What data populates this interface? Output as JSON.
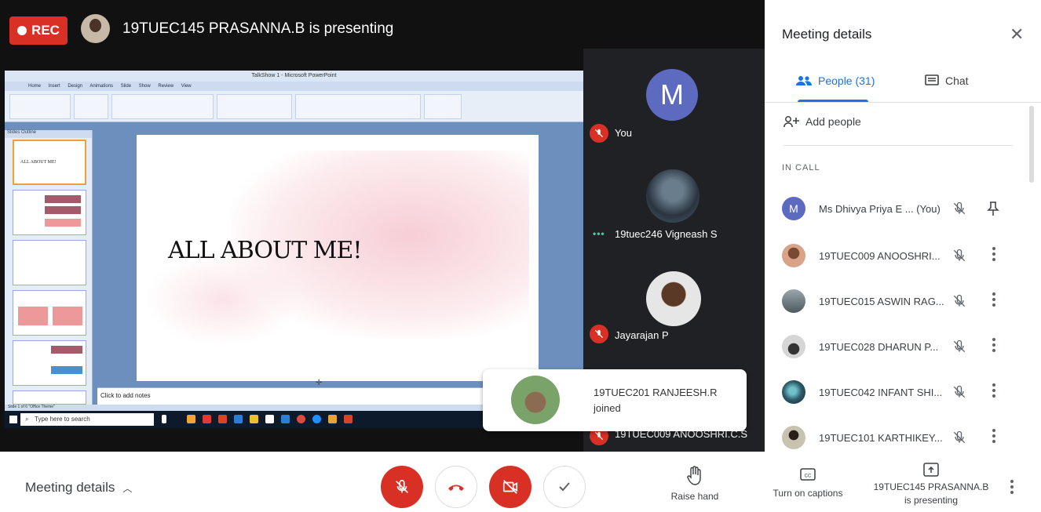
{
  "header": {
    "rec_label": "REC",
    "presenter_title": "19TUEC145 PRASANNA.B is presenting"
  },
  "shared_screen": {
    "window_title": "TalkShow 1 - Microsoft PowerPoint",
    "ribbon_tabs": "Home Insert Design Animations Slide Show Review View",
    "pane_tabs": "Slides  Outline",
    "thumb1_text": "ALL ABOUT ME!",
    "slide_title": "ALL ABOUT ME!",
    "notes_placeholder": "Click to add notes",
    "status_text": "Slide 1 of 6   \"Office Theme\"",
    "taskbar_search": "Type here to search"
  },
  "tiles": [
    {
      "initial": "M",
      "name": "You",
      "avatar_color": "#5c6bc0",
      "muted": true
    },
    {
      "name": "19tuec246 Vigneash S",
      "speaking": true
    },
    {
      "name": "Jayarajan P",
      "muted": true
    },
    {
      "name": "19TUEC009 ANOOSHRI.C.S",
      "muted": true
    }
  ],
  "toast": {
    "line1": "19TUEC201 RANJEESH.R",
    "line2": "joined"
  },
  "panel": {
    "title": "Meeting details",
    "tab_people": "People (31)",
    "tab_chat": "Chat",
    "add_people": "Add people",
    "section_label": "IN CALL",
    "participants": [
      {
        "name": "Ms Dhivya Priya E ... (You)",
        "initial": "M",
        "avatar_color": "#5c6bc0",
        "action_icon": "pin-icon"
      },
      {
        "name": "19TUEC009 ANOOSHRI...",
        "avatar_color": "#d9a38a",
        "action_icon": "more-vert-icon"
      },
      {
        "name": "19TUEC015 ASWIN RAG...",
        "avatar_color": "#7b8a8f",
        "action_icon": "more-vert-icon"
      },
      {
        "name": "19TUEC028 DHARUN P...",
        "avatar_color": "#b5b5b5",
        "action_icon": "more-vert-icon"
      },
      {
        "name": "19TUEC042 INFANT SHI...",
        "avatar_color": "#2e5a66",
        "action_icon": "more-vert-icon"
      },
      {
        "name": "19TUEC101 KARTHIKEY...",
        "avatar_color": "#8d8570",
        "action_icon": "more-vert-icon"
      }
    ]
  },
  "bottom_bar": {
    "meeting_details": "Meeting details",
    "raise_hand": "Raise hand",
    "captions": "Turn on captions",
    "presenting_line1": "19TUEC145 PRASANNA.B",
    "presenting_line2": "is presenting"
  },
  "colors": {
    "red": "#d93025",
    "accent": "#1a73e8",
    "dark": "#202124"
  }
}
